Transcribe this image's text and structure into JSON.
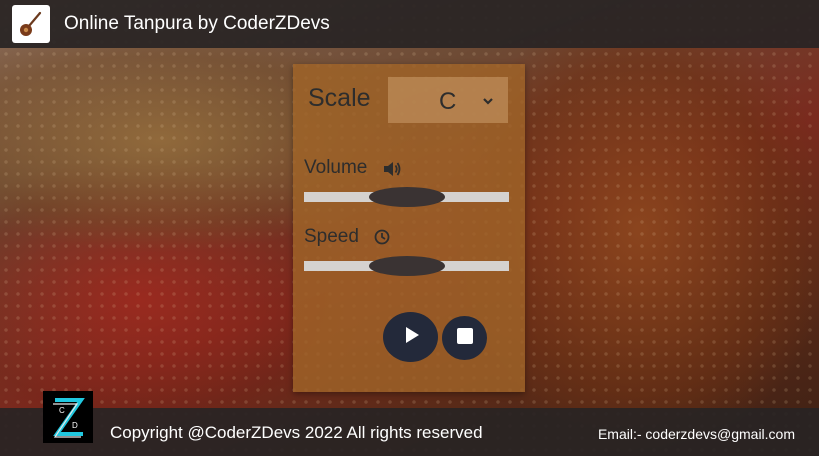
{
  "header": {
    "title": "Online Tanpura by CoderZDevs",
    "logo_icon": "sitar-icon"
  },
  "panel": {
    "scale_label": "Scale",
    "scale_value": "C",
    "volume_label": "Volume",
    "volume_icon": "speaker-icon",
    "volume_level": 0.5,
    "speed_label": "Speed",
    "speed_icon": "clock-icon",
    "speed_level": 0.5,
    "play_icon": "play-icon",
    "stop_icon": "stop-icon"
  },
  "footer": {
    "logo_icon": "coderzdevs-logo",
    "copyright": "Copyright @CoderZDevs 2022 All rights reserved",
    "email": "Email:- coderzdevs@gmail.com"
  },
  "colors": {
    "bar": "#2b2626",
    "panel": "#a0642a",
    "button": "#23293a",
    "slider_track": "#d5d2cf",
    "slider_thumb": "#3a3333",
    "logo_accent": "#20c8e0"
  }
}
